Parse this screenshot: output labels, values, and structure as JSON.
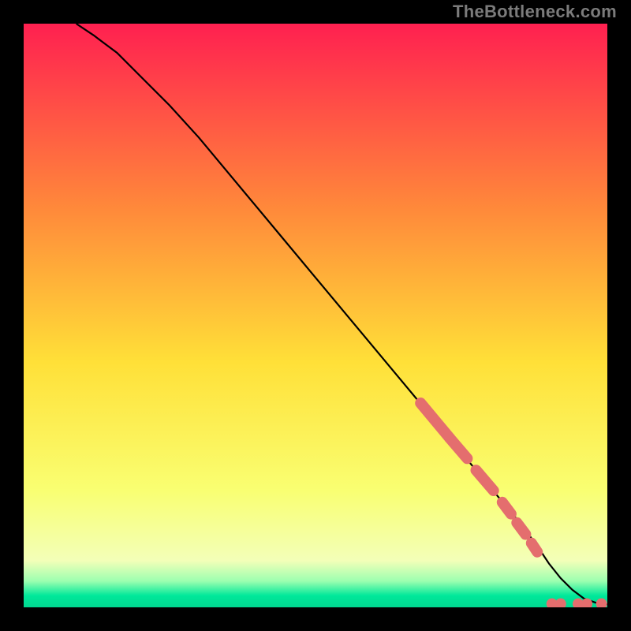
{
  "watermark": "TheBottleneck.com",
  "chart_data": {
    "type": "line",
    "title": "",
    "xlabel": "",
    "ylabel": "",
    "xlim": [
      0,
      100
    ],
    "ylim": [
      0,
      100
    ],
    "curve": {
      "x": [
        9,
        12,
        16,
        20,
        25,
        30,
        35,
        40,
        45,
        50,
        55,
        60,
        65,
        70,
        75,
        80,
        85,
        88,
        90,
        92,
        94,
        96,
        98,
        100
      ],
      "y": [
        100,
        98,
        95,
        91,
        86,
        80.5,
        74.5,
        68.5,
        62.5,
        56.5,
        50.5,
        44.5,
        38.5,
        32.5,
        26.5,
        20.5,
        14.5,
        10.5,
        7.5,
        5,
        3,
        1.5,
        0.8,
        0.5
      ]
    },
    "highlight_segments": [
      {
        "x0": 68,
        "y0": 35,
        "x1": 73,
        "y1": 29
      },
      {
        "x0": 73,
        "y0": 29,
        "x1": 76,
        "y1": 25.5
      },
      {
        "x0": 77.5,
        "y0": 23.5,
        "x1": 80.5,
        "y1": 20
      },
      {
        "x0": 82,
        "y0": 18,
        "x1": 83.5,
        "y1": 16
      },
      {
        "x0": 84.5,
        "y0": 14.5,
        "x1": 86,
        "y1": 12.5
      },
      {
        "x0": 87,
        "y0": 11,
        "x1": 88,
        "y1": 9.5
      }
    ],
    "highlight_dots": [
      {
        "x": 90.5,
        "y": 0.6
      },
      {
        "x": 92,
        "y": 0.6
      },
      {
        "x": 95,
        "y": 0.6
      },
      {
        "x": 96.5,
        "y": 0.6
      },
      {
        "x": 99,
        "y": 0.6
      }
    ],
    "colors": {
      "curve": "#000000",
      "highlight": "#e46e6e",
      "gradient_top": "#ff2050",
      "gradient_mid_upper": "#ff8a3a",
      "gradient_mid": "#ffe038",
      "gradient_lower": "#f9ff72",
      "gradient_green1": "#9cffb0",
      "gradient_green2": "#00e89a"
    }
  }
}
